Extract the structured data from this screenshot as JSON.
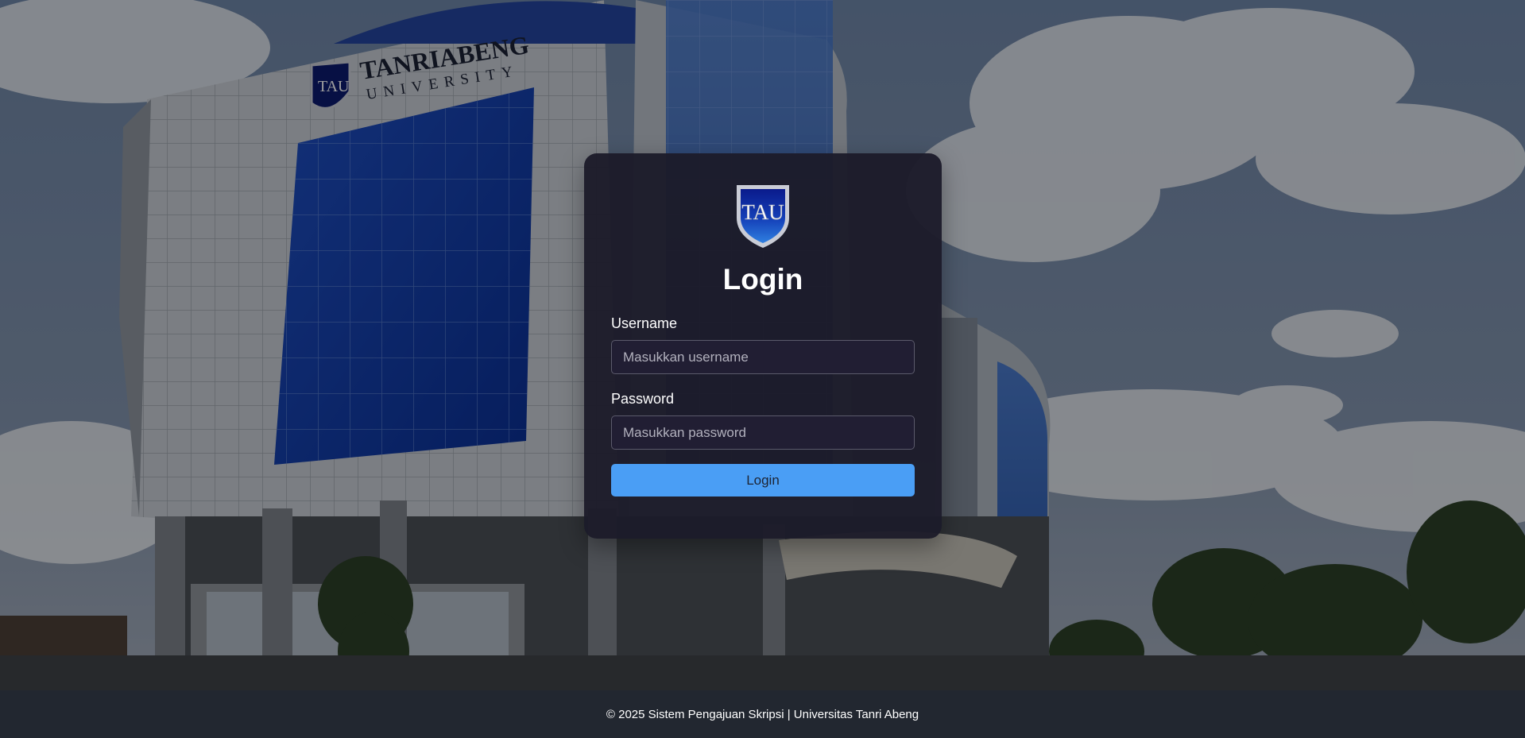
{
  "background": {
    "building_sign_line1": "TANRIABENG",
    "building_sign_line2": "UNIVERSITY",
    "building_logo_text": "TAU"
  },
  "logo": {
    "text": "TAU",
    "colors": {
      "shield_top": "#0a1a8c",
      "shield_bottom": "#2f7fe0",
      "rim": "#c9ccd6"
    }
  },
  "login": {
    "title": "Login",
    "username_label": "Username",
    "username_placeholder": "Masukkan username",
    "username_value": "",
    "password_label": "Password",
    "password_placeholder": "Masukkan password",
    "password_value": "",
    "submit_label": "Login"
  },
  "footer": {
    "text": "© 2025 Sistem Pengajuan Skripsi | Universitas Tanri Abeng"
  },
  "colors": {
    "card_background": "#1c1b2a",
    "input_background": "#211e33",
    "button_accent": "#4a9ef5",
    "footer_background": "#222730"
  }
}
